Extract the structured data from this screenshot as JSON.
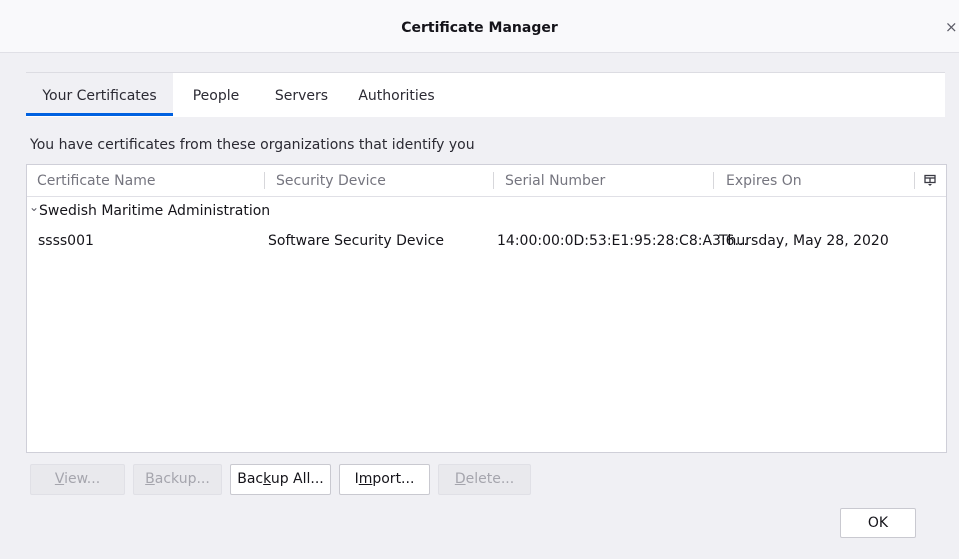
{
  "window": {
    "title": "Certificate Manager",
    "close_glyph": "×"
  },
  "tabs": [
    {
      "label": "Your Certificates",
      "selected": true
    },
    {
      "label": "People",
      "selected": false
    },
    {
      "label": "Servers",
      "selected": false
    },
    {
      "label": "Authorities",
      "selected": false
    }
  ],
  "description": "You have certificates from these organizations that identify you",
  "table": {
    "columns": [
      "Certificate Name",
      "Security Device",
      "Serial Number",
      "Expires On"
    ],
    "column_picker_icon": "column-picker-icon",
    "groups": [
      {
        "twisty": "⌄",
        "name": "Swedish Maritime Administration",
        "expanded": true,
        "rows": [
          {
            "certificate_name": "ssss001",
            "security_device": "Software Security Device",
            "serial_number": "14:00:00:0D:53:E1:95:28:C8:A3:6...",
            "expires_on": "Thursday, May 28, 2020"
          }
        ]
      }
    ]
  },
  "buttons": {
    "view": {
      "pre": "",
      "key": "V",
      "post": "iew...",
      "enabled": false
    },
    "backup": {
      "pre": "",
      "key": "B",
      "post": "ackup...",
      "enabled": false
    },
    "backup_all": {
      "pre": "Bac",
      "key": "k",
      "post": "up All...",
      "enabled": true
    },
    "import": {
      "pre": "I",
      "key": "m",
      "post": "port...",
      "enabled": true
    },
    "delete": {
      "pre": "",
      "key": "D",
      "post": "elete...",
      "enabled": false
    },
    "ok": "OK"
  },
  "colors": {
    "accent": "#0061e0",
    "dialog_bg": "#f0f0f4",
    "muted_text": "#75757f"
  }
}
